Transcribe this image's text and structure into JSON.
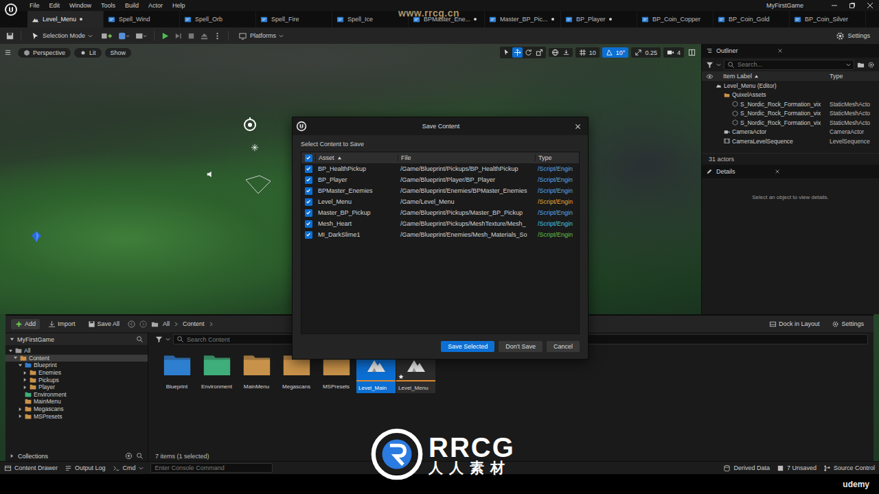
{
  "app": {
    "title": "MyFirstGame",
    "menu": [
      "File",
      "Edit",
      "Window",
      "Tools",
      "Build",
      "Actor",
      "Help"
    ]
  },
  "tabs": [
    {
      "label": "Level_Menu",
      "modified": true,
      "selected": true,
      "kind": "level"
    },
    {
      "label": "Spell_Wind",
      "modified": false,
      "selected": false,
      "kind": "blueprint"
    },
    {
      "label": "Spell_Orb",
      "modified": false,
      "selected": false,
      "kind": "blueprint"
    },
    {
      "label": "Spell_Fire",
      "modified": false,
      "selected": false,
      "kind": "blueprint"
    },
    {
      "label": "Spell_Ice",
      "modified": false,
      "selected": false,
      "kind": "blueprint"
    },
    {
      "label": "BPMaster_Ene...",
      "modified": true,
      "selected": false,
      "kind": "blueprint"
    },
    {
      "label": "Master_BP_Pic...",
      "modified": true,
      "selected": false,
      "kind": "blueprint"
    },
    {
      "label": "BP_Player",
      "modified": true,
      "selected": false,
      "kind": "blueprint"
    },
    {
      "label": "BP_Coin_Copper",
      "modified": false,
      "selected": false,
      "kind": "blueprint"
    },
    {
      "label": "BP_Coin_Gold",
      "modified": false,
      "selected": false,
      "kind": "blueprint"
    },
    {
      "label": "BP_Coin_Silver",
      "modified": false,
      "selected": false,
      "kind": "blueprint"
    }
  ],
  "toolbar": {
    "selection_mode": "Selection Mode",
    "platforms": "Platforms",
    "settings": "Settings"
  },
  "viewport": {
    "view": "Perspective",
    "lighting": "Lit",
    "show": "Show",
    "transform_tools": [
      {
        "tool": "select",
        "selected": false
      },
      {
        "tool": "move",
        "selected": true
      },
      {
        "tool": "rotate",
        "selected": false
      },
      {
        "tool": "scale",
        "selected": false
      }
    ],
    "snaps": [
      {
        "kind": "grid",
        "value": "10",
        "on": false
      },
      {
        "kind": "angle",
        "value": "10°",
        "on": true
      },
      {
        "kind": "scale",
        "value": "0.25",
        "on": false
      },
      {
        "kind": "camera",
        "value": "4",
        "on": false
      }
    ]
  },
  "outliner": {
    "title": "Outliner",
    "search_placeholder": "Search...",
    "columns": [
      {
        "label": "Item Label",
        "sorted": true
      },
      {
        "label": "Type",
        "sorted": false
      }
    ],
    "rows": [
      {
        "label": "Level_Menu (Editor)",
        "type": "",
        "depth": 0,
        "kind": "world"
      },
      {
        "label": "QuixelAssets",
        "type": "",
        "depth": 1,
        "kind": "folder"
      },
      {
        "label": "S_Nordic_Rock_Formation_vix",
        "type": "StaticMeshActo",
        "depth": 2,
        "kind": "mesh"
      },
      {
        "label": "S_Nordic_Rock_Formation_vix",
        "type": "StaticMeshActo",
        "depth": 2,
        "kind": "mesh"
      },
      {
        "label": "S_Nordic_Rock_Formation_vix",
        "type": "StaticMeshActo",
        "depth": 2,
        "kind": "mesh"
      },
      {
        "label": "CameraActor",
        "type": "CameraActor",
        "depth": 1,
        "kind": "camera"
      },
      {
        "label": "CameraLevelSequence",
        "type": "LevelSequence",
        "depth": 1,
        "kind": "sequence"
      }
    ],
    "count": "31 actors"
  },
  "details": {
    "title": "Details",
    "empty_message": "Select an object to view details."
  },
  "content_browser": {
    "toolbar": {
      "add": "Add",
      "import": "Import",
      "save_all": "Save All",
      "breadcrumb": [
        "All",
        "Content"
      ],
      "dock": "Dock in Layout",
      "settings": "Settings"
    },
    "tree_title": "MyFirstGame",
    "tree": [
      {
        "label": "All",
        "depth": 0,
        "has_children": true,
        "expanded": true,
        "selected": false,
        "color": "#9a9a9a"
      },
      {
        "label": "Content",
        "depth": 1,
        "has_children": true,
        "expanded": true,
        "selected": true,
        "color": "#c9924a"
      },
      {
        "label": "Blueprint",
        "depth": 2,
        "has_children": true,
        "expanded": true,
        "selected": false,
        "color": "#2f7fd0"
      },
      {
        "label": "Enemies",
        "depth": 3,
        "has_children": true,
        "expanded": false,
        "selected": false,
        "color": "#c9924a"
      },
      {
        "label": "Pickups",
        "depth": 3,
        "has_children": true,
        "expanded": false,
        "selected": false,
        "color": "#c9924a"
      },
      {
        "label": "Player",
        "depth": 3,
        "has_children": true,
        "expanded": false,
        "selected": false,
        "color": "#c9924a"
      },
      {
        "label": "Environment",
        "depth": 2,
        "has_children": false,
        "expanded": false,
        "selected": false,
        "color": "#3fae7a"
      },
      {
        "label": "MainMenu",
        "depth": 2,
        "has_children": false,
        "expanded": false,
        "selected": false,
        "color": "#c9924a"
      },
      {
        "label": "Megascans",
        "depth": 2,
        "has_children": true,
        "expanded": false,
        "selected": false,
        "color": "#c9924a"
      },
      {
        "label": "MSPresets",
        "depth": 2,
        "has_children": true,
        "expanded": false,
        "selected": false,
        "color": "#c9924a"
      }
    ],
    "collections": "Collections",
    "search_placeholder": "Search Content",
    "items": [
      {
        "label": "Blueprint",
        "kind": "folder",
        "color": "#2f7fd0",
        "selected": false,
        "modified": false
      },
      {
        "label": "Environment",
        "kind": "folder",
        "color": "#3fae7a",
        "selected": false,
        "modified": false
      },
      {
        "label": "MainMenu",
        "kind": "folder",
        "color": "#c9924a",
        "selected": false,
        "modified": false
      },
      {
        "label": "Megascans",
        "kind": "folder",
        "color": "#c9924a",
        "selected": false,
        "modified": false
      },
      {
        "label": "MSPresets",
        "kind": "folder",
        "color": "#c9924a",
        "selected": false,
        "modified": false
      },
      {
        "label": "Level_Main",
        "kind": "level",
        "color": "#e08a2a",
        "selected": true,
        "modified": false
      },
      {
        "label": "Level_Menu",
        "kind": "level",
        "color": "#e08a2a",
        "selected": false,
        "modified": true
      }
    ],
    "count": "7 items (1 selected)"
  },
  "status_bar": {
    "content_drawer": "Content Drawer",
    "output_log": "Output Log",
    "cmd": "Cmd",
    "console_placeholder": "Enter Console Command",
    "derived_data": "Derived Data",
    "unsaved": "7 Unsaved",
    "source_control": "Source Control"
  },
  "dialog": {
    "title": "Save Content",
    "prompt": "Select Content to Save",
    "all_checked": true,
    "columns": [
      {
        "label": "Asset",
        "sorted": true
      },
      {
        "label": "File",
        "sorted": false
      },
      {
        "label": "Type",
        "sorted": false
      }
    ],
    "rows": [
      {
        "asset": "BP_HealthPickup",
        "file": "/Game/Blueprint/Pickups/BP_HealthPickup",
        "type": "/Script/Engin",
        "checked": true,
        "color": "#5aaaf0"
      },
      {
        "asset": "BP_Player",
        "file": "/Game/Blueprint/Player/BP_Player",
        "type": "/Script/Engin",
        "checked": true,
        "color": "#5aaaf0"
      },
      {
        "asset": "BPMaster_Enemies",
        "file": "/Game/Blueprint/Enemies/BPMaster_Enemies",
        "type": "/Script/Engin",
        "checked": true,
        "color": "#5aaaf0"
      },
      {
        "asset": "Level_Menu",
        "file": "/Game/Level_Menu",
        "type": "/Script/Engin",
        "checked": true,
        "color": "#e8a838"
      },
      {
        "asset": "Master_BP_Pickup",
        "file": "/Game/Blueprint/Pickups/Master_BP_Pickup",
        "type": "/Script/Engin",
        "checked": true,
        "color": "#5aaaf0"
      },
      {
        "asset": "Mesh_Heart",
        "file": "/Game/Blueprint/Pickups/MeshTexture/Mesh_",
        "type": "/Script/Engin",
        "checked": true,
        "color": "#44c8e8"
      },
      {
        "asset": "MI_DarkSlime1",
        "file": "/Game/Blueprint/Enemies/Mesh_Materials_So",
        "type": "/Script/Engin",
        "checked": true,
        "color": "#66c24a"
      }
    ],
    "buttons": [
      {
        "label": "Save Selected",
        "primary": true
      },
      {
        "label": "Don't Save",
        "primary": false
      },
      {
        "label": "Cancel",
        "primary": false
      }
    ]
  },
  "watermark": {
    "site": "www.rrcg.cn",
    "logo": "RRCG",
    "logo_sub": "人人素材",
    "course": "udemy"
  }
}
